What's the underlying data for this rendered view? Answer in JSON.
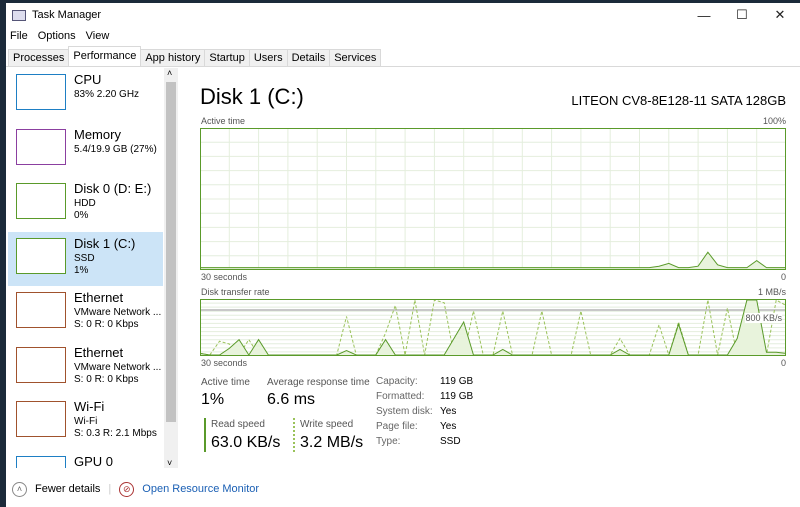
{
  "window": {
    "title": "Task Manager",
    "minimize": "—",
    "maximize": "☐",
    "close": "✕"
  },
  "menu": [
    "File",
    "Options",
    "View"
  ],
  "tabs": [
    "Processes",
    "Performance",
    "App history",
    "Startup",
    "Users",
    "Details",
    "Services"
  ],
  "active_tab": "Performance",
  "sidebar": {
    "items": [
      {
        "name": "CPU",
        "line1": "83%  2.20 GHz",
        "line2": "",
        "color": "#1e7fc4"
      },
      {
        "name": "Memory",
        "line1": "5.4/19.9 GB (27%)",
        "line2": "",
        "color": "#8b3fa0"
      },
      {
        "name": "Disk 0 (D: E:)",
        "line1": "HDD",
        "line2": "0%",
        "color": "#5a9a2a"
      },
      {
        "name": "Disk 1 (C:)",
        "line1": "SSD",
        "line2": "1%",
        "color": "#5a9a2a",
        "selected": true
      },
      {
        "name": "Ethernet",
        "line1": "VMware Network ...",
        "line2": "S: 0 R: 0 Kbps",
        "color": "#a0522d"
      },
      {
        "name": "Ethernet",
        "line1": "VMware Network ...",
        "line2": "S: 0 R: 0 Kbps",
        "color": "#a0522d"
      },
      {
        "name": "Wi-Fi",
        "line1": "Wi-Fi",
        "line2": "S: 0.3 R: 2.1 Mbps",
        "color": "#a0522d"
      },
      {
        "name": "GPU 0",
        "line1": "",
        "line2": "",
        "color": "#1e7fc4"
      }
    ]
  },
  "main": {
    "title": "Disk 1 (C:)",
    "model": "LITEON CV8-8E128-11 SATA 128GB",
    "active_chart": {
      "label": "Active time",
      "max": "100%",
      "time": "30 seconds",
      "min": "0",
      "values": [
        1,
        1,
        1,
        1,
        1,
        1,
        1,
        1,
        1,
        1,
        1,
        1,
        1,
        1,
        1,
        1,
        1,
        1,
        1,
        1,
        1,
        1,
        1,
        1,
        1,
        1,
        1,
        1,
        1,
        1,
        1,
        1,
        1,
        1,
        1,
        1,
        1,
        1,
        1,
        1,
        1,
        1,
        1,
        1,
        1,
        1,
        1,
        2,
        4,
        1,
        1,
        2,
        12,
        3,
        1,
        1,
        1,
        6,
        1,
        1,
        1
      ]
    },
    "transfer_chart": {
      "label": "Disk transfer rate",
      "max": "1 MB/s",
      "mid": "800 KB/s",
      "time": "30 seconds",
      "min": "0",
      "read_values": [
        30,
        0,
        0,
        120,
        280,
        0,
        280,
        0,
        0,
        0,
        0,
        0,
        0,
        0,
        0,
        80,
        0,
        0,
        0,
        280,
        0,
        0,
        0,
        0,
        0,
        0,
        300,
        600,
        0,
        0,
        0,
        100,
        0,
        0,
        0,
        0,
        0,
        0,
        0,
        0,
        0,
        0,
        0,
        100,
        0,
        0,
        0,
        0,
        0,
        560,
        0,
        0,
        0,
        0,
        0,
        300,
        1000,
        1000,
        50,
        50,
        30
      ],
      "write_values": [
        30,
        0,
        250,
        200,
        0,
        280,
        0,
        0,
        0,
        0,
        0,
        0,
        0,
        0,
        0,
        700,
        0,
        0,
        0,
        400,
        900,
        0,
        1000,
        0,
        1000,
        950,
        0,
        0,
        800,
        0,
        0,
        800,
        0,
        0,
        0,
        800,
        0,
        0,
        0,
        800,
        0,
        0,
        0,
        300,
        0,
        0,
        0,
        550,
        0,
        600,
        0,
        0,
        1000,
        0,
        850,
        0,
        1000,
        0,
        0,
        1000,
        900
      ]
    },
    "stats": {
      "active_time_label": "Active time",
      "active_time": "1%",
      "avg_resp_label": "Average response time",
      "avg_resp": "6.6 ms",
      "read_label": "Read speed",
      "read": "63.0 KB/s",
      "write_label": "Write speed",
      "write": "3.2 MB/s"
    },
    "props": [
      [
        "Capacity:",
        "119 GB"
      ],
      [
        "Formatted:",
        "119 GB"
      ],
      [
        "System disk:",
        "Yes"
      ],
      [
        "Page file:",
        "Yes"
      ],
      [
        "Type:",
        "SSD"
      ]
    ]
  },
  "footer": {
    "fewer": "Fewer details",
    "monitor": "Open Resource Monitor"
  },
  "colors": {
    "disk": "#5a9a2a",
    "selected": "#cce4f7"
  }
}
